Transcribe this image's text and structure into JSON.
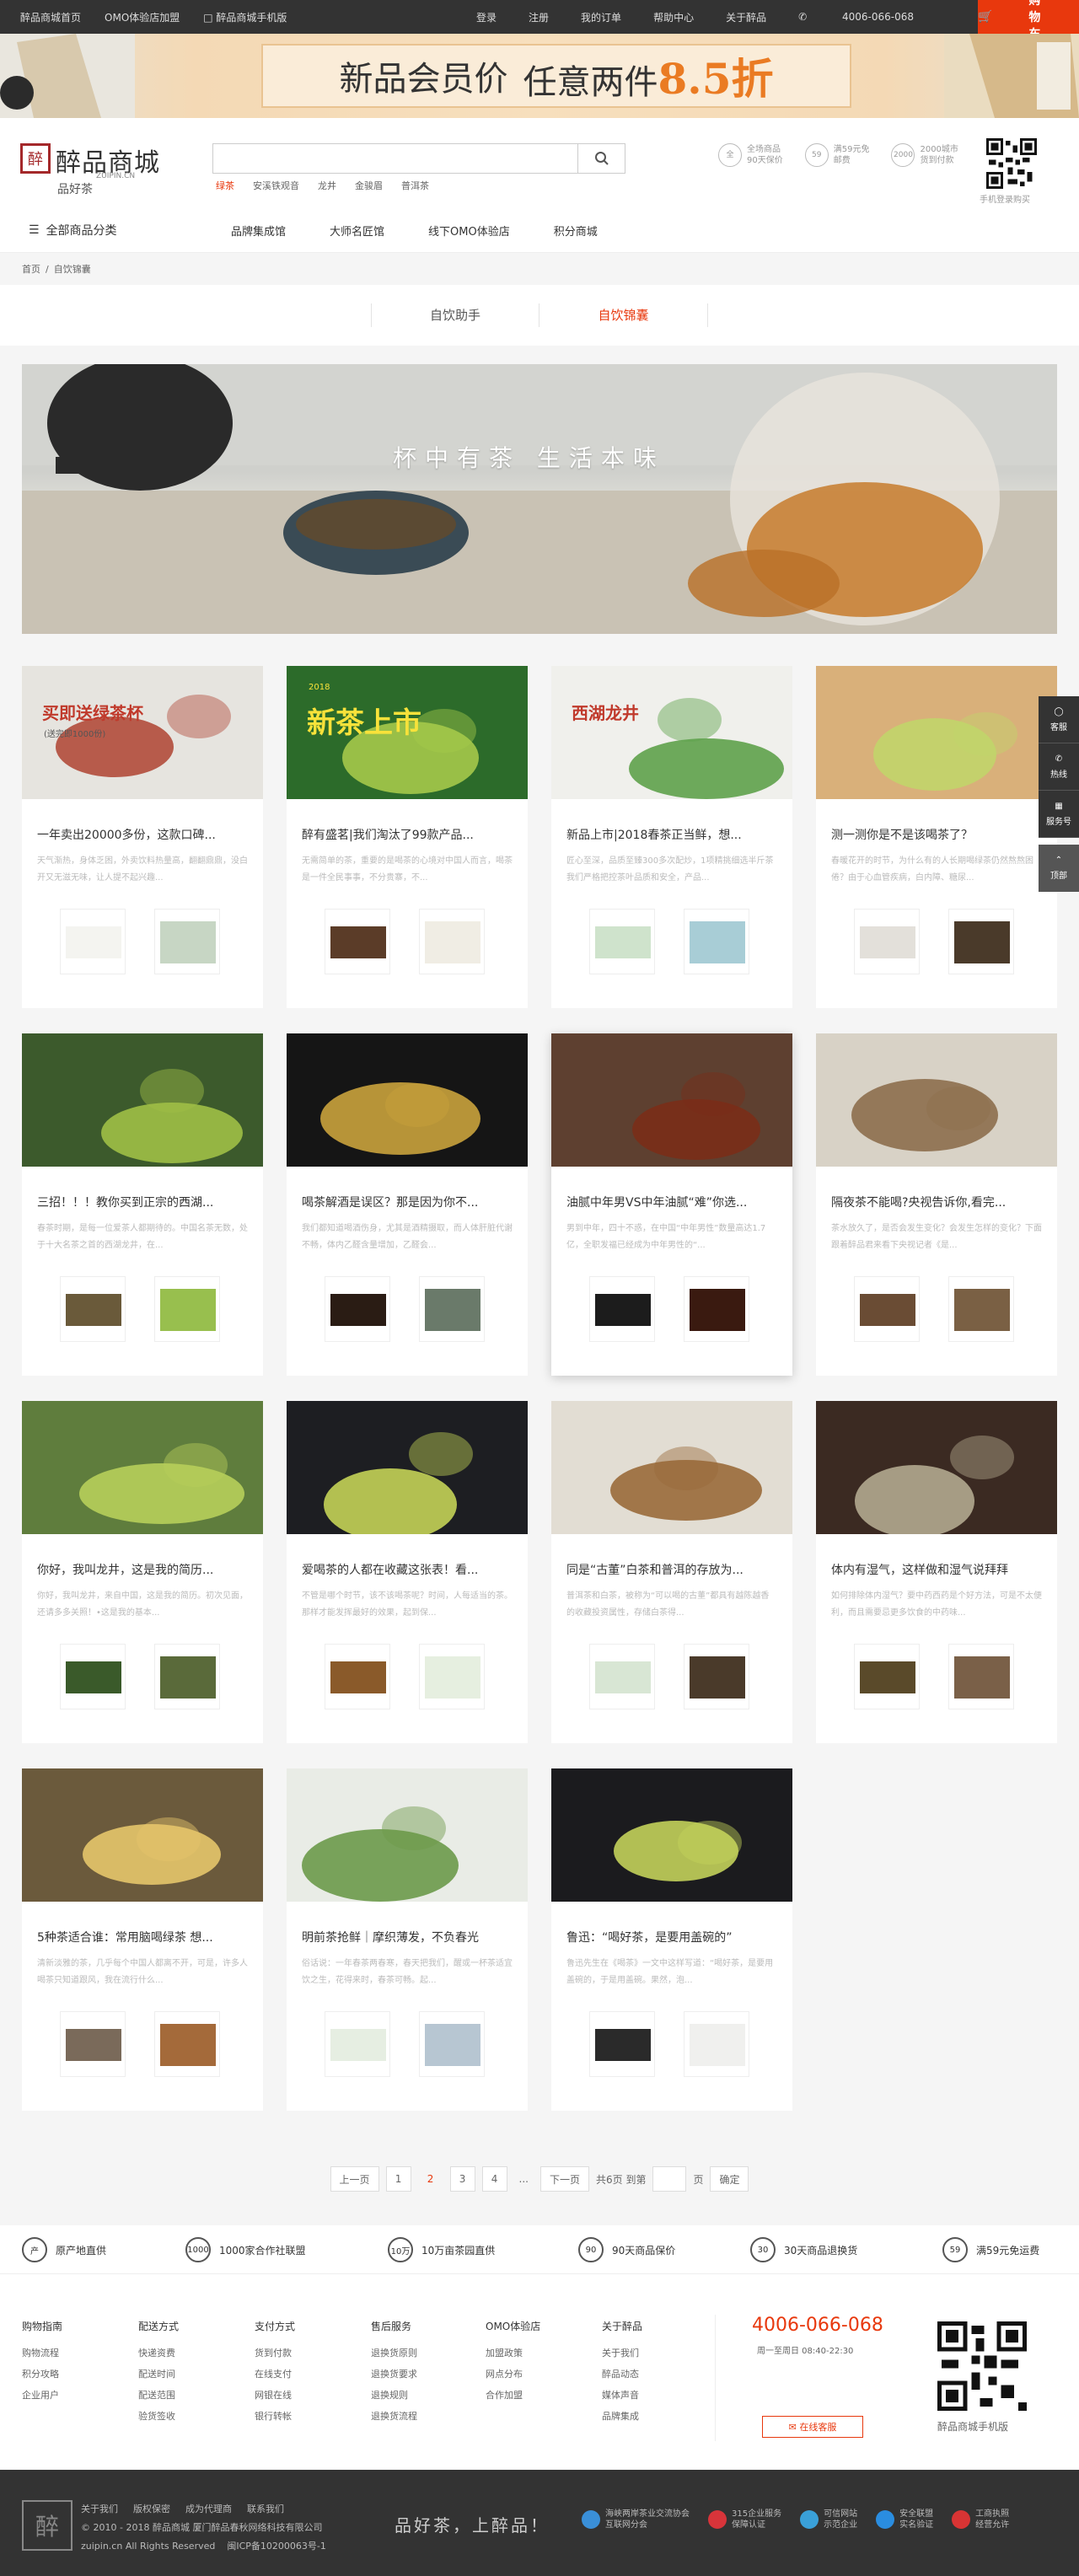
{
  "topbar": {
    "links_left": [
      "醉品商城首页",
      "OMO体验店加盟",
      "醉品商城手机版"
    ],
    "links_right": [
      "登录",
      "注册",
      "我的订单",
      "帮助中心",
      "关于醉品"
    ],
    "phone": "4006-066-068",
    "cart": "购物车"
  },
  "promo": {
    "text": "新品会员价",
    "text2": "任意两件",
    "discount": "8.5折"
  },
  "header": {
    "logo_name": "醉品商城",
    "logo_domain": "ZUIPIN.CN",
    "logo_sub": "品好茶",
    "search_placeholder": "",
    "hot_keywords": [
      "绿茶",
      "安溪铁观音",
      "龙井",
      "金骏眉",
      "普洱茶"
    ],
    "badges": [
      {
        "icon": "全",
        "line1": "全场商品",
        "line2": "90天保价"
      },
      {
        "icon": "59",
        "line1": "满59元免",
        "line2": "邮费"
      },
      {
        "icon": "2000",
        "line1": "2000城市",
        "line2": "货到付款"
      }
    ],
    "qr_label": "手机登录购买"
  },
  "nav": {
    "all_categories": "全部商品分类",
    "items": [
      "品牌集成馆",
      "大师名匠馆",
      "线下OMO体验店",
      "积分商城"
    ]
  },
  "breadcrumb": {
    "home": "首页",
    "sep": "/",
    "current": "自饮锦囊"
  },
  "tabs": {
    "tab1": "自饮助手",
    "tab2": "自饮锦囊"
  },
  "hero": {
    "slogan": "杯中有茶 生活本味"
  },
  "cards": [
    {
      "title": "一年卖出20000多份，这款口碑...",
      "desc": "天气渐热，身体乏困，外卖饮料热量高，翻翻鼎鼎，没白开又无滋无味，让人提不起兴趣...",
      "banner": [
        "买即送绿茶杯",
        "(送完即1000份)"
      ]
    },
    {
      "title": "醉有盛茗|我们淘汰了99款产品...",
      "desc": "无需简单的茶，重要的是喝茶的心境对中国人而言，喝茶是一件全民事事，不分贵寨，不...",
      "banner": [
        "新茶上市",
        "2018"
      ]
    },
    {
      "title": "新品上市|2018春茶正当鲜，想...",
      "desc": "匠心至深，品质至臻300多次配炒，1项精挑细选半斤茶我们严格把控茶叶品质和安全，产品...",
      "banner": [
        "西湖龙井"
      ]
    },
    {
      "title": "测一测你是不是该喝茶了？",
      "desc": "春暖花开的时节，为什么有的人长期喝绿茶仍然熬熬困倦？由于心血管疾病，白内障、糖尿...",
      "banner": []
    },
    {
      "title": "三招！！！教你买到正宗的西湖...",
      "desc": "春茶时期，是每一位爱茶人都期待的。中国名茶无数，处于十大名茶之首的西湖龙井，在...",
      "banner": []
    },
    {
      "title": "喝茶解酒是误区？那是因为你不...",
      "desc": "我们都知道喝酒伤身，尤其是酒精摄取，而人体肝脏代谢不畅，体内乙醛含量增加，乙醛会...",
      "banner": []
    },
    {
      "title": "油腻中年男VS中年油腻“难”你选...",
      "desc": "男到中年，四十不惑，在中国“中年男性”数量高达1.7亿，全职发福已经成为中年男性的“...",
      "banner": []
    },
    {
      "title": "隔夜茶不能喝?央视告诉你,看完...",
      "desc": "茶水放久了，是否会发生变化？会发生怎样的变化？下面跟着醉品君来看下央视记者《是...",
      "banner": []
    },
    {
      "title": "你好，我叫龙井，这是我的简历...",
      "desc": "你好，我叫龙井，来自中国，这是我的简历。初次见面，还请多多关照！•这是我的基本...",
      "banner": []
    },
    {
      "title": "爱喝茶的人都在收藏这张表！看...",
      "desc": "不管是哪个时节，该不该喝茶呢？时间，人每适当的茶。那样才能发挥最好的效果，起到保...",
      "banner": []
    },
    {
      "title": "同是“古董”白茶和普洱的存放为...",
      "desc": "普洱茶和白茶，被称为“可以喝的古董”都具有越陈越香的收藏投资属性，存储白茶得...",
      "banner": []
    },
    {
      "title": "体内有湿气，这样做和湿气说拜拜",
      "desc": "如何排除体内湿气？要中药西药是个好方法，可是不太便利，而且需要忌更多饮食的中药味...",
      "banner": []
    },
    {
      "title": "5种茶适合谁：常用脑喝绿茶 想...",
      "desc": "清新淡雅的茶，几乎每个中国人都离不开，可是，许多人喝茶只知道跟风，我在流行什么...",
      "banner": []
    },
    {
      "title": "明前茶抢鲜｜摩织薄发，不负春光",
      "desc": "俗话说：一年春茶两春寒，春天把我们，醒或一杯茶适宜饮之生，花得来时，春茶可畅。起...",
      "banner": []
    },
    {
      "title": "鲁迅：“喝好茶，是要用盖碗的”",
      "desc": "鲁迅先生在《喝茶》一文中这样写道：“喝好茶，是要用盖碗的，于是用盖碗。果然，泡...",
      "banner": []
    }
  ],
  "sidebar_float": [
    "客服",
    "热线",
    "服务号",
    "顶部"
  ],
  "pagination": {
    "prev": "上一页",
    "pages": [
      "1",
      "2",
      "3",
      "4"
    ],
    "current": "2",
    "ellipsis": "...",
    "next": "下一页",
    "total": "共6页 到第",
    "page_unit": "页",
    "confirm": "确定"
  },
  "services": [
    "原产地直供",
    "1000家合作社联盟",
    "10万亩茶园直供",
    "90天商品保价",
    "30天商品退换货",
    "满59元免运费"
  ],
  "service_icons": [
    "产",
    "1000",
    "10万",
    "90",
    "30",
    "59"
  ],
  "footer": {
    "columns": [
      {
        "title": "购物指南",
        "items": [
          "购物流程",
          "积分攻略",
          "企业用户"
        ]
      },
      {
        "title": "配送方式",
        "items": [
          "快递资费",
          "配送时间",
          "配送范围",
          "验货签收"
        ]
      },
      {
        "title": "支付方式",
        "items": [
          "货到付款",
          "在线支付",
          "网银在线",
          "银行转帐"
        ]
      },
      {
        "title": "售后服务",
        "items": [
          "退换货原则",
          "退换货要求",
          "退换规则",
          "退换货流程"
        ]
      },
      {
        "title": "OMO体验店",
        "items": [
          "加盟政策",
          "网点分布",
          "合作加盟"
        ]
      },
      {
        "title": "关于醉品",
        "items": [
          "关于我们",
          "醉品动态",
          "媒体声音",
          "品牌集成"
        ]
      }
    ],
    "phone": "4006-066-068",
    "hours": "周一至周日 08:40-22:30",
    "online": "在线客服",
    "qr_label": "醉品商城手机版"
  },
  "bottom": {
    "logo_char": "醉",
    "links": [
      "关于我们",
      "版权保密",
      "成为代理商",
      "联系我们"
    ],
    "copyright": "© 2010 - 2018 醉品商城 厦门醉品春秋网络科技有限公司",
    "rights": "zuipin.cn All Rights Reserved",
    "icp": "闽ICP备10200063号-1",
    "slogan": "品好茶，上醉品！",
    "certs": [
      {
        "l1": "海峡两岸茶业交流协会",
        "l2": "互联网分会",
        "color": "#3a8fd8"
      },
      {
        "l1": "315企业服务",
        "l2": "保障认证",
        "color": "#d8343a"
      },
      {
        "l1": "可信网站",
        "l2": "示范企业",
        "color": "#3aa0d8"
      },
      {
        "l1": "安全联盟",
        "l2": "实名验证",
        "color": "#2a8de0"
      },
      {
        "l1": "工商执照",
        "l2": "经营允许",
        "color": "#d83434"
      }
    ]
  }
}
